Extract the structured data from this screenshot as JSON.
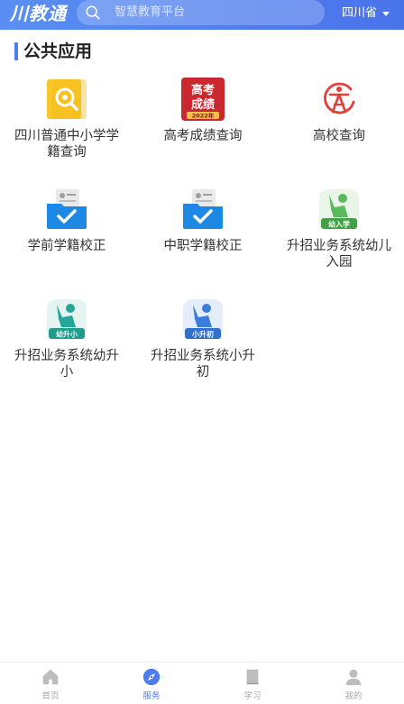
{
  "header": {
    "logo": "川教通",
    "search_placeholder": "智慧教育平台",
    "region": "四川省"
  },
  "section": {
    "title": "公共应用"
  },
  "apps": [
    {
      "label": "四川普通中小学学籍查询",
      "icon": "search-badge-icon"
    },
    {
      "label": "高考成绩查询",
      "icon": "gaokao-score-icon",
      "badge_line1": "高考",
      "badge_line2": "成绩",
      "badge_year": "2022年"
    },
    {
      "label": "高校查询",
      "icon": "university-icon"
    },
    {
      "label": "学前学籍校正",
      "icon": "folder-check-icon"
    },
    {
      "label": "中职学籍校正",
      "icon": "folder-check-icon"
    },
    {
      "label": "升招业务系统幼儿入园",
      "icon": "child-enroll-icon",
      "tag": "幼入学"
    },
    {
      "label": "升招业务系统幼升小",
      "icon": "kinder-to-primary-icon",
      "tag": "幼升小"
    },
    {
      "label": "升招业务系统小升初",
      "icon": "primary-to-middle-icon",
      "tag": "小升初"
    }
  ],
  "tabs": [
    {
      "label": "首页",
      "icon": "home-icon",
      "active": false
    },
    {
      "label": "服务",
      "icon": "compass-icon",
      "active": true
    },
    {
      "label": "学习",
      "icon": "book-icon",
      "active": false
    },
    {
      "label": "我的",
      "icon": "user-icon",
      "active": false
    }
  ],
  "colors": {
    "brand": "#4f7dee",
    "header_gradient_start": "#5a8ff2",
    "gaokao_red": "#c8282e",
    "university_red": "#e0413a",
    "folder_blue": "#1e88e5",
    "green": "#4caf50"
  }
}
